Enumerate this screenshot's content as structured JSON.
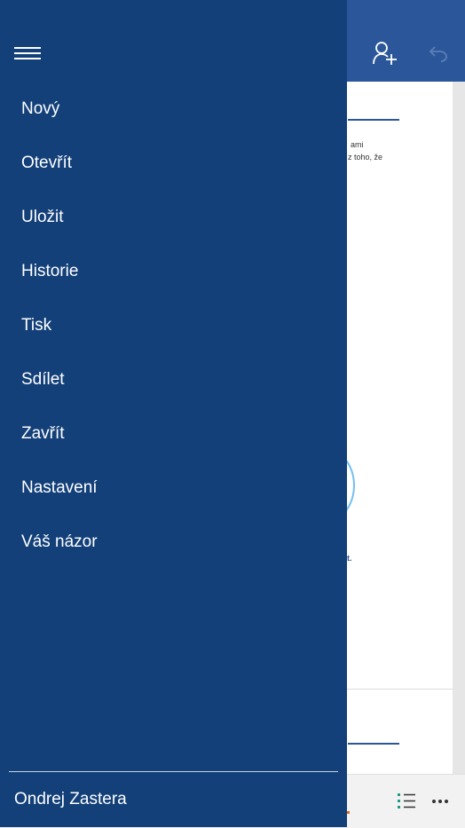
{
  "colors": {
    "drawer_bg": "#134079",
    "app_bar": "#2b579a",
    "accent_circle": "#73bff0",
    "text_on_dark": "#ffffff"
  },
  "toolbar": {
    "share_icon": "person-add-icon",
    "undo_icon": "undo-icon"
  },
  "document": {
    "snippet_1": "ami",
    "snippet_2": "z toho, že",
    "snippet_3": "t."
  },
  "drawer": {
    "menu_icon": "hamburger-icon",
    "items": [
      {
        "label": "Nový"
      },
      {
        "label": "Otevřít"
      },
      {
        "label": "Uložit"
      },
      {
        "label": "Historie"
      },
      {
        "label": "Tisk"
      },
      {
        "label": "Sdílet"
      },
      {
        "label": "Zavřít"
      },
      {
        "label": "Nastavení"
      },
      {
        "label": "Váš názor"
      }
    ],
    "account": "Ondrej Zastera"
  },
  "bottom_bar": {
    "list_icon": "list-icon",
    "more_icon": "more-icon"
  }
}
